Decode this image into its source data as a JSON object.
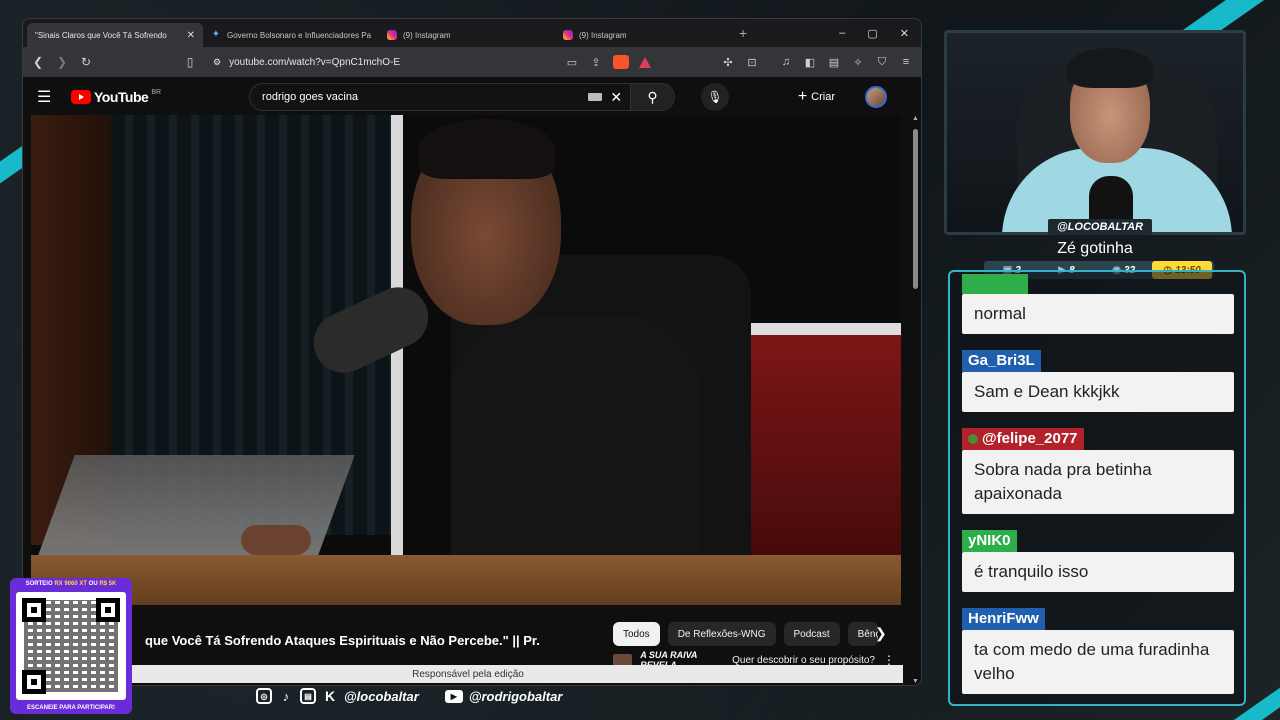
{
  "browser": {
    "tabs": [
      {
        "title": "\"Sinais Claros que Você Tá Sofrendo",
        "icon": "youtube-favicon",
        "active": true
      },
      {
        "title": "Governo Bolsonaro e Influenciadores Pagos",
        "icon": "gemini-favicon",
        "active": false
      },
      {
        "title": "(9) Instagram",
        "icon": "instagram-favicon",
        "active": false
      },
      {
        "title": "(9) Instagram",
        "icon": "instagram-favicon",
        "active": false
      }
    ],
    "url": "youtube.com/watch?v=QpnC1mchO-E",
    "window_controls": [
      "–",
      "▢",
      "✕"
    ]
  },
  "youtube": {
    "logo": "YouTube",
    "region": "BR",
    "search_query": "rodrigo goes vacina",
    "create_label": "Criar",
    "video_title": "que Você Tá Sofrendo Ataques Espirituais e Não Percebe.\" || Pr.",
    "chips": [
      "Todos",
      "De Reflexões-WNG",
      "Podcast",
      "Bênç"
    ],
    "recommendation": {
      "thumb_text": "A SUA RAIVA REVELA",
      "title": "Quer descobrir o seu propósito?"
    },
    "edit_label": "Responsável pela edição"
  },
  "overlay": {
    "cam_handle": "@LOCOBALTAR",
    "game": "Zé gotinha",
    "stats": {
      "chat": "2",
      "video": "8",
      "viewers": "32"
    },
    "time": "13:50",
    "qr": {
      "top_prefix": "SORTEIO",
      "top_prize": "RX 9060 XT",
      "top_mid": "OU",
      "top_value": "R$ 5K",
      "bottom": "ESCANEIE PARA PARTICIPAR!"
    },
    "socials": {
      "handle1": "@locobaltar",
      "handle2": "@rodrigobaltar"
    }
  },
  "chat": [
    {
      "user": "",
      "user_color": "#2eae4a",
      "text": "normal"
    },
    {
      "user": "Ga_Bri3L",
      "user_color": "#1f5fae",
      "text": "Sam e Dean kkkjkk"
    },
    {
      "user": "@felipe_2077",
      "user_color": "#b3222a",
      "text": "Sobra nada pra betinha apaixonada"
    },
    {
      "user": "yNIK0",
      "user_color": "#2eae4a",
      "text": "é tranquilo isso"
    },
    {
      "user": "HenriFww",
      "user_color": "#1f5fae",
      "text": "ta com medo de uma furadinha velho"
    }
  ]
}
